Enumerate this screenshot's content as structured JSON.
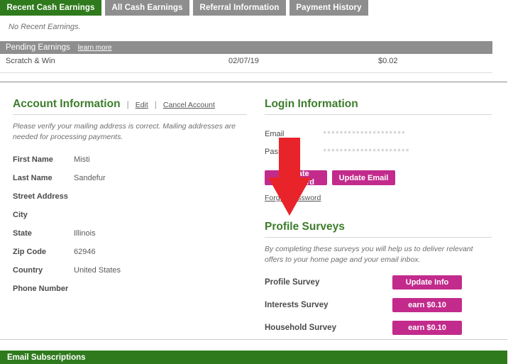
{
  "tabs": [
    {
      "label": "Recent Cash Earnings",
      "active": true
    },
    {
      "label": "All Cash Earnings",
      "active": false
    },
    {
      "label": "Referral Information",
      "active": false
    },
    {
      "label": "Payment History",
      "active": false
    }
  ],
  "recent": {
    "empty_message": "No Recent Earnings."
  },
  "pending": {
    "title": "Pending Earnings",
    "learn_more": "learn more",
    "rows": [
      {
        "name": "Scratch & Win",
        "date": "02/07/19",
        "amount": "$0.02"
      }
    ]
  },
  "account": {
    "heading": "Account Information",
    "edit_label": "Edit",
    "cancel_label": "Cancel Account",
    "separator": "|",
    "note": "Please verify your mailing address is correct. Mailing addresses are needed for processing payments.",
    "fields": [
      {
        "label": "First Name",
        "value": "Misti"
      },
      {
        "label": "Last Name",
        "value": "Sandefur"
      },
      {
        "label": "Street Address",
        "value": ""
      },
      {
        "label": "City",
        "value": ""
      },
      {
        "label": "State",
        "value": "Illinois"
      },
      {
        "label": "Zip Code",
        "value": "62946"
      },
      {
        "label": "Country",
        "value": "United States"
      },
      {
        "label": "Phone Number",
        "value": ""
      }
    ]
  },
  "login": {
    "heading": "Login Information",
    "email_label": "Email",
    "email_value": "********************",
    "password_label": "Password",
    "password_value": "*********************",
    "update_password_label": "Update Password",
    "update_email_label": "Update Email",
    "forgot_label": "Forgot Password"
  },
  "surveys": {
    "heading": "Profile Surveys",
    "note": "By completing these surveys you will help us to deliver relevant offers to your home page and your email inbox.",
    "rows": [
      {
        "label": "Profile Survey",
        "button": "Update Info"
      },
      {
        "label": "Interests Survey",
        "button": "earn $0.10"
      },
      {
        "label": "Household Survey",
        "button": "earn $0.10"
      }
    ]
  },
  "footer": {
    "email_subscriptions": "Email Subscriptions"
  },
  "annotation": {
    "arrow_icon": "down-arrow-icon",
    "arrow_color": "#E8232A"
  },
  "colors": {
    "tab_active": "#2F7A1D",
    "tab_inactive": "#8E8E8E",
    "heading_green": "#3C7D2B",
    "button_magenta": "#C22B8C",
    "bar_gray": "#8E8E8E"
  }
}
